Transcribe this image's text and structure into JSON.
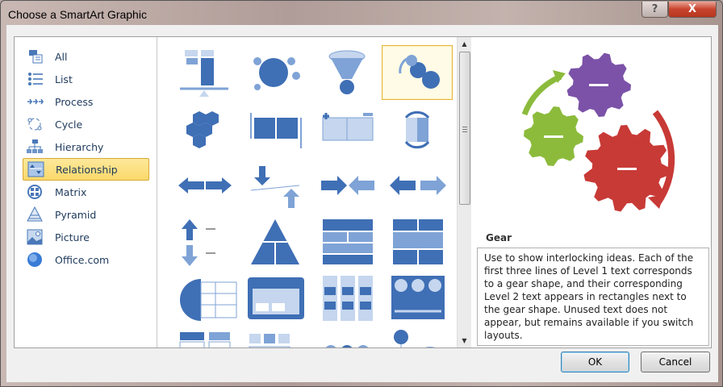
{
  "window": {
    "title": "Choose a SmartArt Graphic",
    "help_label": "?",
    "close_label": "X"
  },
  "categories": [
    {
      "label": "All",
      "icon": "all-icon"
    },
    {
      "label": "List",
      "icon": "list-icon"
    },
    {
      "label": "Process",
      "icon": "process-icon"
    },
    {
      "label": "Cycle",
      "icon": "cycle-icon"
    },
    {
      "label": "Hierarchy",
      "icon": "hierarchy-icon"
    },
    {
      "label": "Relationship",
      "icon": "relationship-icon",
      "selected": true
    },
    {
      "label": "Matrix",
      "icon": "matrix-icon"
    },
    {
      "label": "Pyramid",
      "icon": "pyramid-icon"
    },
    {
      "label": "Picture",
      "icon": "picture-icon"
    },
    {
      "label": "Office.com",
      "icon": "office-com-icon"
    }
  ],
  "gallery": {
    "selected_index": 3,
    "count": 24
  },
  "preview": {
    "name": "Gear",
    "description": "Use to show interlocking ideas. Each of the first three lines of Level 1 text corresponds to a gear shape, and their corresponding Level 2 text appears in rectangles next to the gear shape. Unused text does not appear, but remains available if you switch layouts.",
    "colors": {
      "purple": "#7b52a8",
      "green": "#8cbb3c",
      "red": "#c83a36"
    }
  },
  "buttons": {
    "ok": "OK",
    "cancel": "Cancel"
  }
}
